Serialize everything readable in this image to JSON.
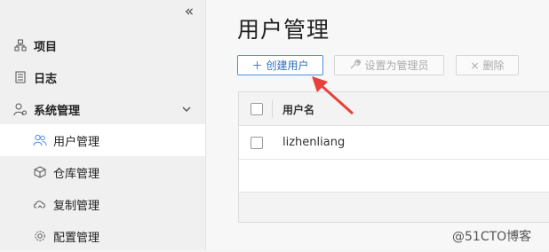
{
  "sidebar": {
    "collapse_glyph": "«",
    "items": [
      {
        "label": "项目"
      },
      {
        "label": "日志"
      },
      {
        "label": "系统管理"
      }
    ],
    "sub_items": [
      {
        "label": "用户管理"
      },
      {
        "label": "仓库管理"
      },
      {
        "label": "复制管理"
      },
      {
        "label": "配置管理"
      }
    ]
  },
  "main": {
    "title": "用户管理",
    "buttons": {
      "create": "创建用户",
      "set_admin": "设置为管理员",
      "delete": "删除"
    },
    "table": {
      "header_username": "用户名",
      "rows": [
        {
          "username": "lizhenliang"
        }
      ]
    }
  },
  "watermark": "@51CTO博客",
  "colors": {
    "accent": "#4a90e2",
    "arrow": "#e8413c"
  }
}
